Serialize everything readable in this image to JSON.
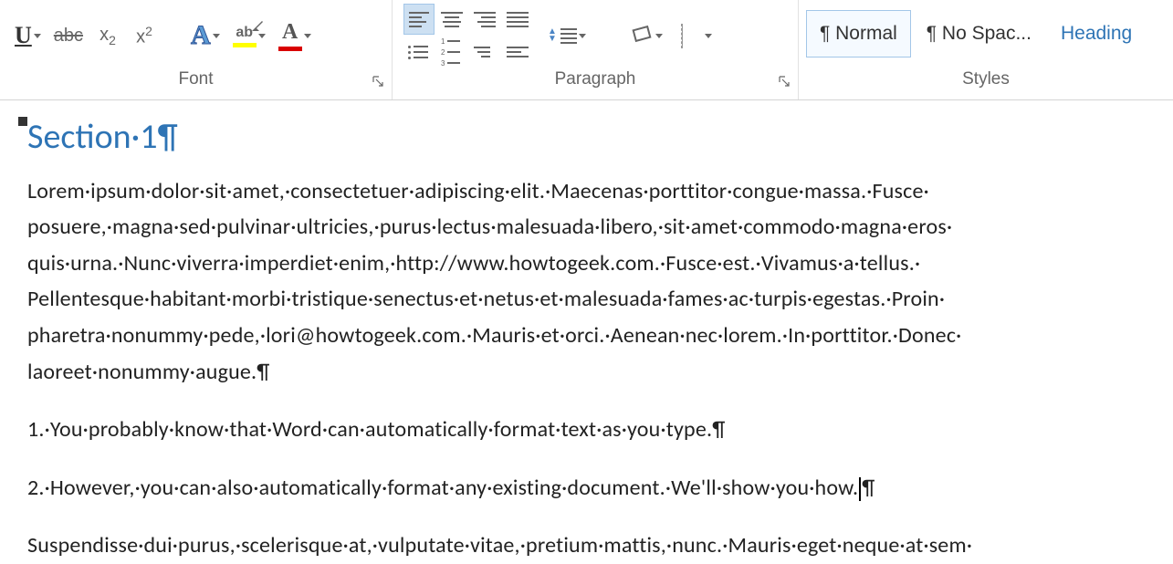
{
  "ribbon": {
    "font": {
      "label": "Font",
      "underline": "U",
      "strike": "abc",
      "subscript": "x",
      "subscript_sub": "2",
      "superscript": "x",
      "superscript_sup": "2",
      "text_effects": "A",
      "highlight": "ab",
      "highlight_color": "#ffff00",
      "font_color_glyph": "A",
      "font_color": "#d90000"
    },
    "paragraph": {
      "label": "Paragraph"
    },
    "styles": {
      "label": "Styles",
      "items": [
        {
          "label": "¶ Normal",
          "selected": true
        },
        {
          "label": "¶ No Spac...",
          "selected": false
        },
        {
          "label": "Heading",
          "selected": false
        }
      ]
    }
  },
  "document": {
    "heading": "Section·1¶",
    "paragraph1": "Lorem·ipsum·dolor·sit·amet,·consectetuer·adipiscing·elit.·Maecenas·porttitor·congue·massa.·Fusce· posuere,·magna·sed·pulvinar·ultricies,·purus·lectus·malesuada·libero,·sit·amet·commodo·magna·eros· quis·urna.·Nunc·viverra·imperdiet·enim,·http://www.howtogeek.com.·Fusce·est.·Vivamus·a·tellus.· Pellentesque·habitant·morbi·tristique·senectus·et·netus·et·malesuada·fames·ac·turpis·egestas.·Proin· pharetra·nonummy·pede,·lori@howtogeek.com.·Mauris·et·orci.·Aenean·nec·lorem.·In·porttitor.·Donec· laoreet·nonummy·augue.¶",
    "line2": "1.·You·probably·know·that·Word·can·automatically·format·text·as·you·type.¶",
    "line3_pre": "2.·However,·you·can·also·automatically·format·any·existing·document.·We'll·show·you·how.",
    "line3_post": "¶",
    "paragraph4": "Suspendisse·dui·purus,·scelerisque·at,·vulputate·vitae,·pretium·mattis,·nunc.·Mauris·eget·neque·at·sem·"
  }
}
